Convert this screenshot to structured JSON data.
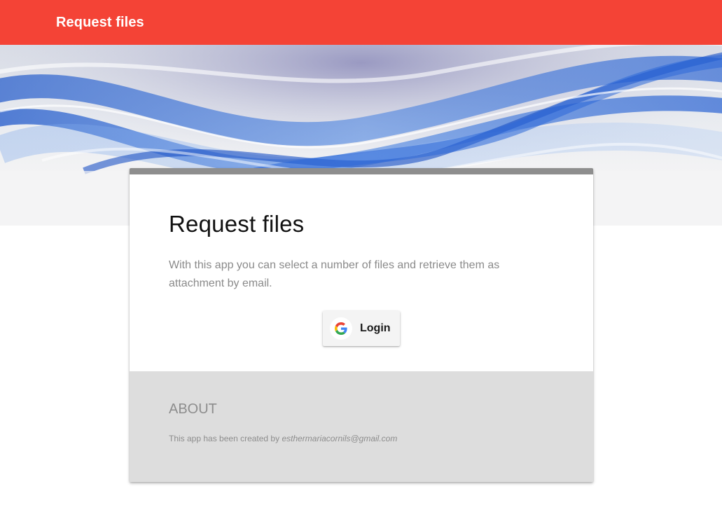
{
  "appbar": {
    "title": "Request files"
  },
  "colors": {
    "primary": "#f44336",
    "card_topbar": "#8e8e8e",
    "footer_bg": "#dddddd"
  },
  "hero": {
    "image": "abstract-blue-waves"
  },
  "card": {
    "title": "Request files",
    "description": "With this app you can select a number of files and retrieve them as attachment by email.",
    "login_button": {
      "label": "Login",
      "icon": "google-icon"
    }
  },
  "about": {
    "title": "ABOUT",
    "text_prefix": "This app has been created by",
    "email": "esthermariacornils@gmail.com"
  }
}
